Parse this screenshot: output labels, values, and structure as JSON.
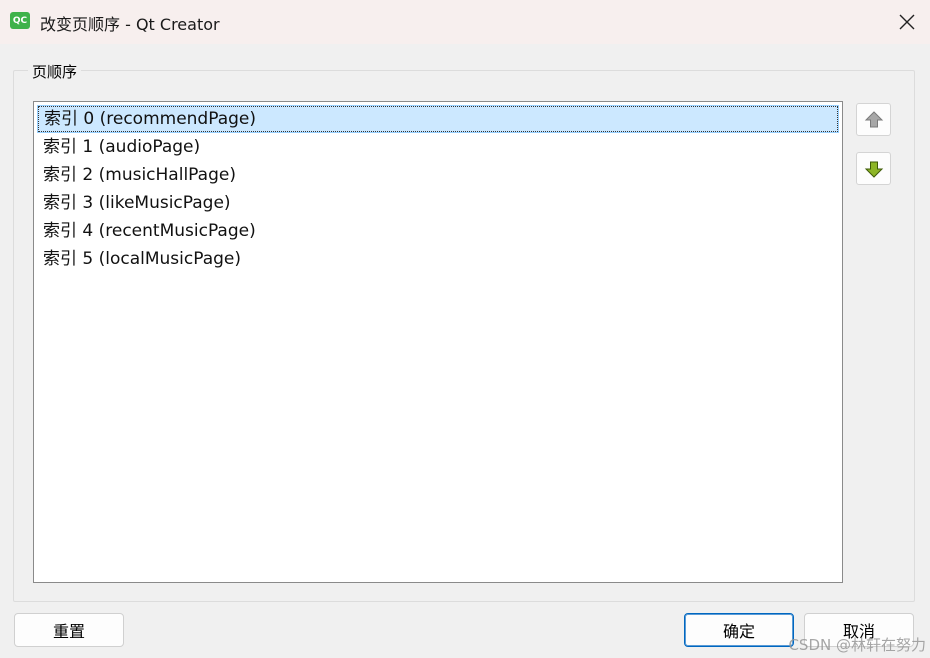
{
  "window": {
    "icon_text": "QC",
    "title": "改变页顺序 - Qt Creator"
  },
  "group": {
    "title": "页顺序"
  },
  "list": {
    "items": [
      {
        "label": "索引 0 (recommendPage)",
        "selected": true
      },
      {
        "label": "索引 1 (audioPage)",
        "selected": false
      },
      {
        "label": "索引 2 (musicHallPage)",
        "selected": false
      },
      {
        "label": "索引 3 (likeMusicPage)",
        "selected": false
      },
      {
        "label": "索引 4 (recentMusicPage)",
        "selected": false
      },
      {
        "label": "索引 5 (localMusicPage)",
        "selected": false
      }
    ]
  },
  "side_buttons": {
    "up_icon": "arrow-up-icon",
    "down_icon": "arrow-down-icon",
    "down_color": "#7ca31c",
    "up_color": "#9a9a9a"
  },
  "buttons": {
    "reset": "重置",
    "ok": "确定",
    "cancel": "取消"
  },
  "watermark": "CSDN @林轩在努力"
}
